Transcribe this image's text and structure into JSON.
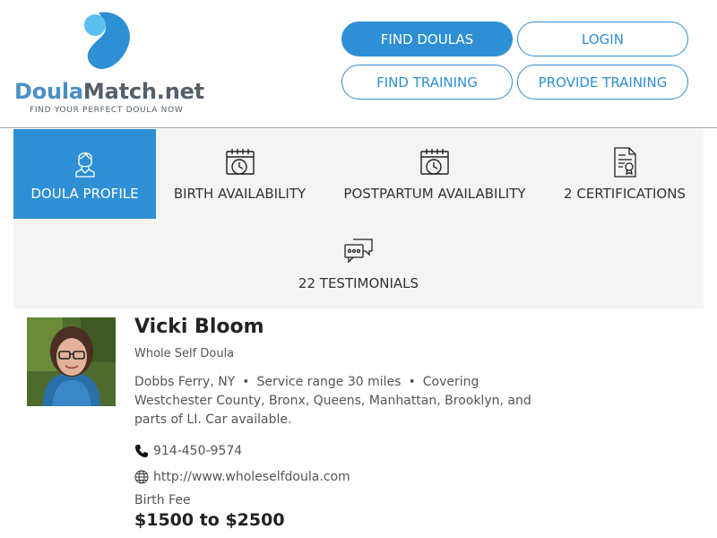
{
  "brand": {
    "name_part1": "Doula",
    "name_part2": "Match.net",
    "tagline": "FIND YOUR PERFECT DOULA NOW",
    "colors": {
      "primary": "#2e8fd4",
      "logo_blue": "#4a8fc3",
      "logo_light": "#5bc0f0",
      "logo_gray": "#555f6a"
    }
  },
  "nav": {
    "find_doulas": "FIND DOULAS",
    "login": "LOGIN",
    "find_training": "FIND TRAINING",
    "provide_training": "PROVIDE TRAINING"
  },
  "tabs": [
    {
      "label": "DOULA PROFILE",
      "icon": "doula-profile-icon",
      "active": true
    },
    {
      "label": "BIRTH AVAILABILITY",
      "icon": "calendar-clock-icon",
      "active": false
    },
    {
      "label": "POSTPARTUM AVAILABILITY",
      "icon": "calendar-clock-icon",
      "active": false
    },
    {
      "label": "2 CERTIFICATIONS",
      "icon": "certificate-icon",
      "active": false
    },
    {
      "label": "22 TESTIMONIALS",
      "icon": "chat-bubbles-icon",
      "active": false
    }
  ],
  "profile": {
    "name": "Vicki Bloom",
    "title": "Whole Self Doula",
    "city": "Dobbs Ferry, NY",
    "service_range": "Service range 30 miles",
    "coverage": "Covering Westchester County, Bronx, Queens, Manhattan, Brooklyn, and parts of LI. Car available.",
    "phone": "914-450-9574",
    "website": "http://www.wholeselfdoula.com",
    "fee_label": "Birth Fee",
    "fee_value": "$1500 to $2500"
  }
}
